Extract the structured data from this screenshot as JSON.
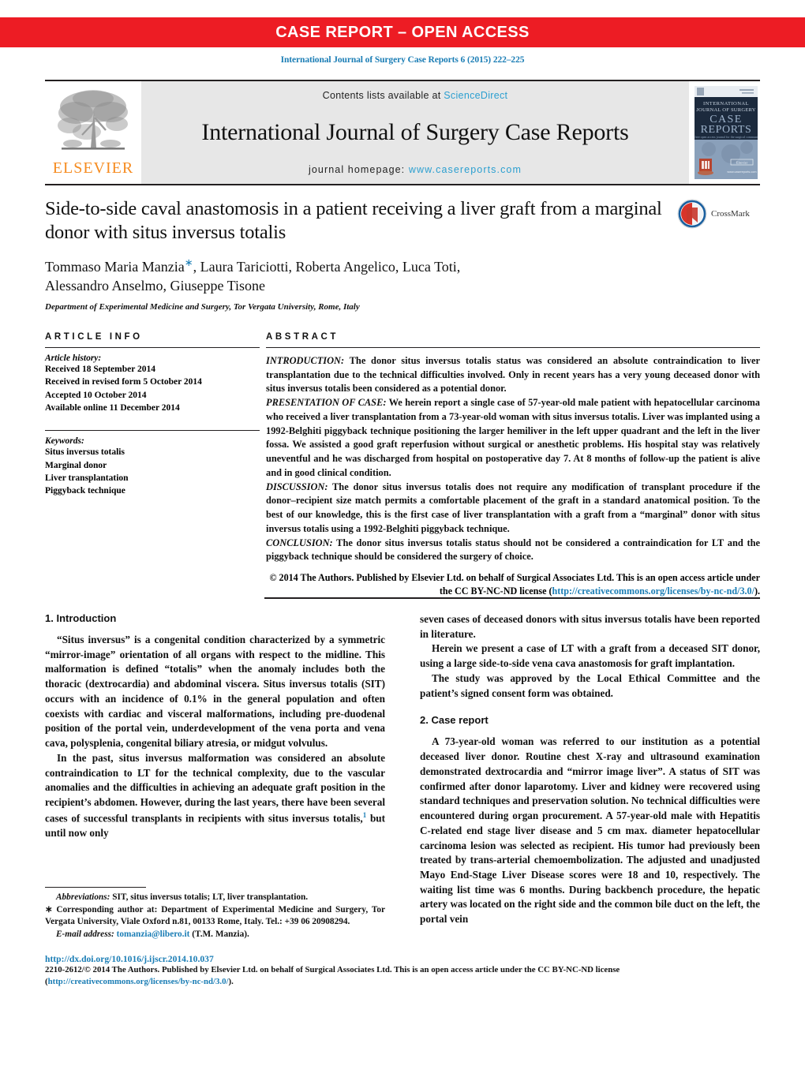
{
  "banner": {
    "text": "CASE REPORT – OPEN ACCESS",
    "bg_color": "#ED1C24",
    "text_color": "#FFFFFF"
  },
  "running_head": "International Journal of Surgery Case Reports 6 (2015) 222–225",
  "masthead": {
    "publisher_wordmark": "ELSEVIER",
    "publisher_color": "#F68B1F",
    "contents_prefix": "Contents lists available at ",
    "contents_link": "ScienceDirect",
    "journal_title": "International Journal of Surgery Case Reports",
    "homepage_prefix": "journal homepage: ",
    "homepage_url": "www.casereports.com",
    "link_color": "#2b9fd0",
    "cover": {
      "line1": "INTERNATIONAL",
      "line2": "JOURNAL OF SURGERY",
      "line3": "CASE",
      "line4": "REPORTS",
      "tagline": "A free open access journal for the surgical community",
      "footer_url": "www.casereports.com"
    }
  },
  "article": {
    "title": "Side-to-side caval anastomosis in a patient receiving a liver graft from a marginal donor with situs inversus totalis",
    "authors": "Tommaso Maria Manzia",
    "authors_rest": ", Laura Tariciotti, Roberta Angelico, Luca Toti,",
    "authors_line2": "Alessandro Anselmo, Giuseppe Tisone",
    "corresponding_marker": "∗",
    "affiliation": "Department of Experimental Medicine and Surgery, Tor Vergata University, Rome, Italy",
    "crossmark_label": "CrossMark"
  },
  "article_info": {
    "heading": "ARTICLE INFO",
    "history_label": "Article history:",
    "history": [
      "Received 18 September 2014",
      "Received in revised form 5 October 2014",
      "Accepted 10 October 2014",
      "Available online 11 December 2014"
    ],
    "keywords_label": "Keywords:",
    "keywords": [
      "Situs inversus totalis",
      "Marginal donor",
      "Liver transplantation",
      "Piggyback technique"
    ]
  },
  "abstract": {
    "heading": "ABSTRACT",
    "sections": [
      {
        "lead": "INTRODUCTION:",
        "text": " The donor situs inversus totalis status was considered an absolute contraindication to liver transplantation due to the technical difficulties involved. Only in recent years has a very young deceased donor with situs inversus totalis been considered as a potential donor."
      },
      {
        "lead": "PRESENTATION OF CASE:",
        "text": " We herein report a single case of 57-year-old male patient with hepatocellular carcinoma who received a liver transplantation from a 73-year-old woman with situs inversus totalis. Liver was implanted using a 1992-Belghiti piggyback technique positioning the larger hemiliver in the left upper quadrant and the left in the liver fossa. We assisted a good graft reperfusion without surgical or anesthetic problems. His hospital stay was relatively uneventful and he was discharged from hospital on postoperative day 7. At 8 months of follow-up the patient is alive and in good clinical condition."
      },
      {
        "lead": "DISCUSSION:",
        "text": " The donor situs inversus totalis does not require any modification of transplant procedure if the donor–recipient size match permits a comfortable placement of the graft in a standard anatomical position. To the best of our knowledge, this is the first case of liver transplantation with a graft from a “marginal” donor with situs inversus totalis using a 1992-Belghiti piggyback technique."
      },
      {
        "lead": "CONCLUSION:",
        "text": " The donor situs inversus totalis status should not be considered a contraindication for LT and the piggyback technique should be considered the surgery of choice."
      }
    ],
    "copyright_text": "© 2014 The Authors. Published by Elsevier Ltd. on behalf of Surgical Associates Ltd. This is an open access article under the CC BY-NC-ND license (",
    "copyright_link": "http://creativecommons.org/licenses/by-nc-nd/3.0/",
    "copyright_tail": ")."
  },
  "body": {
    "left": {
      "section1_heading": "1.  Introduction",
      "p1": "“Situs inversus” is a congenital condition characterized by a symmetric “mirror-image” orientation of all organs with respect to the midline. This malformation is defined “totalis” when the anomaly includes both the thoracic (dextrocardia) and abdominal viscera. Situs inversus totalis (SIT) occurs with an incidence of 0.1% in the general population and often coexists with cardiac and visceral malformations, including pre-duodenal position of the portal vein, underdevelopment of the vena porta and vena cava, polysplenia, congenital biliary atresia, or midgut volvulus.",
      "p2_a": "In the past, situs inversus malformation was considered an absolute contraindication to LT for the technical complexity, due to the vascular anomalies and the difficulties in achieving an adequate graft position in the recipient’s abdomen. However, during the last years, there have been several cases of successful transplants in recipients with situs inversus totalis,",
      "p2_sup": "1",
      "p2_b": " but until now only"
    },
    "right": {
      "p1_cont": "seven cases of deceased donors with situs inversus totalis have been reported in literature.",
      "p2": "Herein we present a case of LT with a graft from a deceased SIT donor, using a large side-to-side vena cava anastomosis for graft implantation.",
      "p3": "The study was approved by the Local Ethical Committee and the patient’s signed consent form was obtained.",
      "section2_heading": "2.  Case report",
      "p4": "A 73-year-old woman was referred to our institution as a potential deceased liver donor. Routine chest X-ray and ultrasound examination demonstrated dextrocardia and “mirror image liver”. A status of SIT was confirmed after donor laparotomy. Liver and kidney were recovered using standard techniques and preservation solution. No technical difficulties were encountered during organ procurement. A 57-year-old male with Hepatitis C-related end stage liver disease and 5 cm max. diameter hepatocellular carcinoma lesion was selected as recipient. His tumor had previously been treated by trans-arterial chemoembolization. The adjusted and unadjusted Mayo End-Stage Liver Disease scores were 18 and 10, respectively. The waiting list time was 6 months. During backbench procedure, the hepatic artery was located on the right side and the common bile duct on the left, the portal vein"
    }
  },
  "footnotes": {
    "abbreviations_label": "Abbreviations:",
    "abbreviations_text": " SIT, situs inversus totalis; LT, liver transplantation.",
    "corresponding_marker": "∗",
    "corresponding_text": " Corresponding author at: Department of Experimental Medicine and Surgery, Tor Vergata University, Viale Oxford n.81, 00133 Rome, Italy. Tel.: +39 06 20908294.",
    "email_label": "E-mail address:",
    "email_link": "tomanzia@libero.it",
    "email_tail": " (T.M. Manzia)."
  },
  "bottom": {
    "doi": "http://dx.doi.org/10.1016/j.ijscr.2014.10.037",
    "copyright_a": "2210-2612/© 2014 The Authors. Published by Elsevier Ltd. on behalf of Surgical Associates Ltd. This is an open access article under the CC BY-NC-ND license",
    "copyright_open": "(",
    "copyright_link": "http://creativecommons.org/licenses/by-nc-nd/3.0/",
    "copyright_close": ")."
  }
}
